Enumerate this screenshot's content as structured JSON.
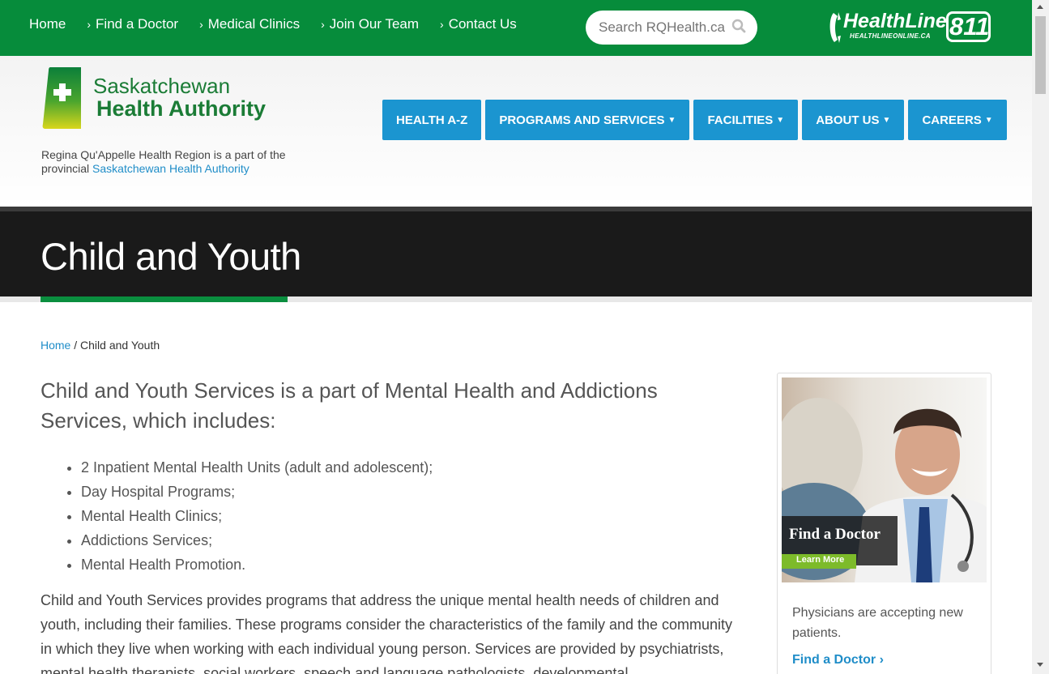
{
  "topnav": {
    "items": [
      {
        "label": "Home",
        "chevron": false
      },
      {
        "label": "Find a Doctor",
        "chevron": true
      },
      {
        "label": "Medical Clinics",
        "chevron": true
      },
      {
        "label": "Join Our Team",
        "chevron": true
      },
      {
        "label": "Contact Us",
        "chevron": true
      }
    ],
    "search_placeholder": "Search RQHealth.ca",
    "healthline": {
      "brand": "HealthLine",
      "number": "811",
      "url_text": "HEALTHLINEONLINE.CA"
    }
  },
  "header": {
    "logo_line1": "Saskatchewan",
    "logo_line2": "Health Authority",
    "tagline_text": "Regina Qu'Appelle Health Region is a part of the provincial ",
    "tagline_link": "Saskatchewan Health Authority",
    "nav": [
      {
        "label": "HEALTH A-Z",
        "dropdown": false
      },
      {
        "label": "PROGRAMS AND SERVICES",
        "dropdown": true
      },
      {
        "label": "FACILITIES",
        "dropdown": true
      },
      {
        "label": "ABOUT US",
        "dropdown": true
      },
      {
        "label": "CAREERS",
        "dropdown": true
      }
    ]
  },
  "page": {
    "title": "Child and Youth",
    "breadcrumb_home": "Home",
    "breadcrumb_sep": " / ",
    "breadcrumb_current": "Child and Youth",
    "lead": "Child and Youth Services is a part of Mental Health and Addictions Services, which includes:",
    "bullets": [
      "2 Inpatient Mental Health Units (adult and adolescent);",
      "Day Hospital Programs;",
      "Mental Health Clinics;",
      "Addictions Services;",
      "Mental Health Promotion."
    ],
    "body": "Child and Youth Services provides programs that address the unique mental health needs of children and youth, including their families. These programs consider the characteristics of the family and the community in which they live when working with each individual young person. Services are provided by psychiatrists, mental health therapists, social workers, speech and language pathologists, developmental"
  },
  "sidebar": {
    "image_title": "Find a Doctor",
    "image_button": "Learn More",
    "caption": "Physicians are accepting new patients.",
    "link": "Find a Doctor",
    "link_chevron": "›"
  },
  "colors": {
    "topbar": "#068c3b",
    "nav_button": "#1b95d0",
    "title_band": "#1a1a1a",
    "accent_green": "#0a8e3f",
    "link_blue": "#1f8dc8"
  }
}
